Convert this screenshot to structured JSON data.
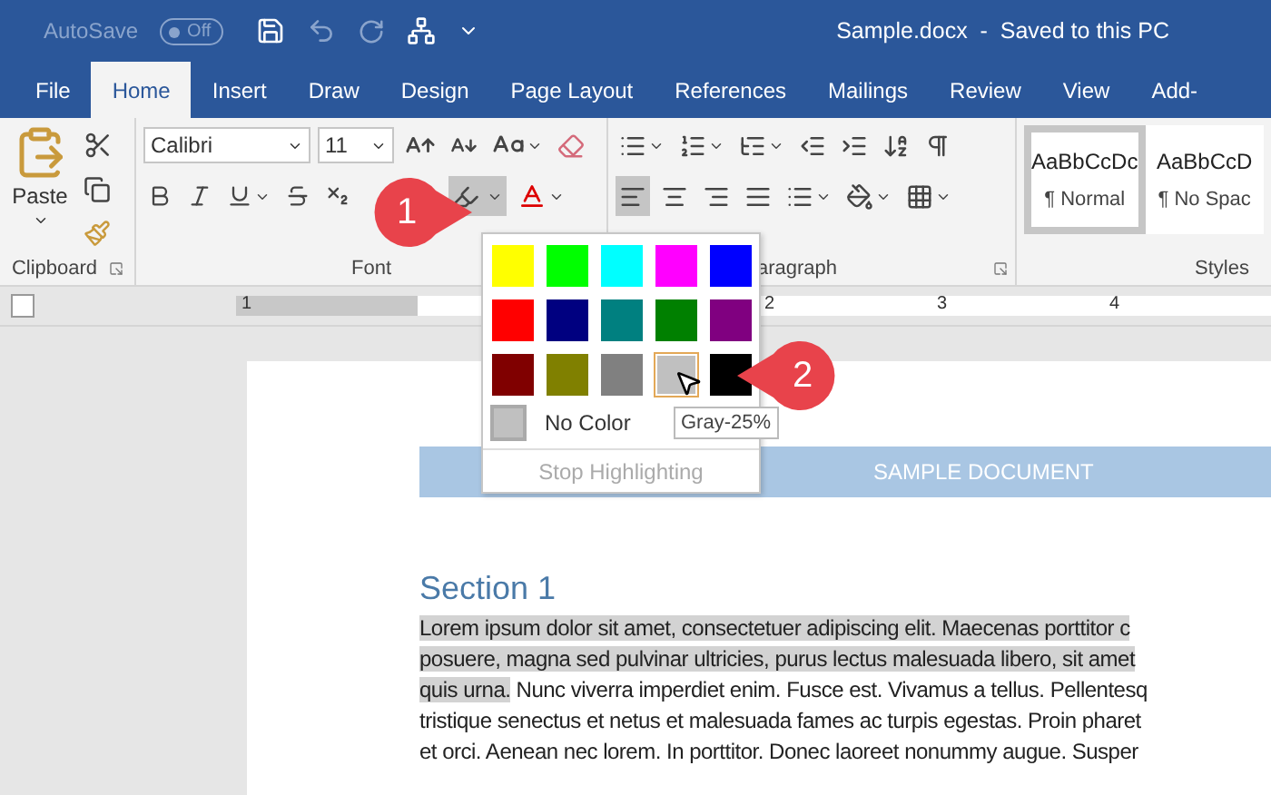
{
  "title_bar": {
    "autosave_label": "AutoSave",
    "autosave_state": "Off",
    "autosave_on": false,
    "document_title": "Sample.docx  -  Saved to this PC"
  },
  "tabs": [
    {
      "label": "File",
      "selected": false
    },
    {
      "label": "Home",
      "selected": true
    },
    {
      "label": "Insert",
      "selected": false
    },
    {
      "label": "Draw",
      "selected": false
    },
    {
      "label": "Design",
      "selected": false
    },
    {
      "label": "Page Layout",
      "selected": false
    },
    {
      "label": "References",
      "selected": false
    },
    {
      "label": "Mailings",
      "selected": false
    },
    {
      "label": "Review",
      "selected": false
    },
    {
      "label": "View",
      "selected": false
    },
    {
      "label": "Add-",
      "selected": false
    }
  ],
  "ribbon": {
    "clipboard": {
      "paste_label": "Paste",
      "group_label": "Clipboard"
    },
    "font": {
      "font_name": "Calibri",
      "font_size": "11",
      "highlight_open": true,
      "group_label": "Font"
    },
    "paragraph": {
      "alignments": [
        {
          "kind": "left",
          "selected": true
        },
        {
          "kind": "center",
          "selected": false
        },
        {
          "kind": "right",
          "selected": false
        },
        {
          "kind": "justify",
          "selected": false
        }
      ],
      "group_label": "aragraph"
    },
    "styles": {
      "items": [
        {
          "preview": "AaBbCcDc",
          "name": "¶ Normal",
          "selected": true
        },
        {
          "preview": "AaBbCcD",
          "name": "¶ No Spac",
          "selected": false
        }
      ],
      "group_label": "Styles"
    }
  },
  "ruler": {
    "numbers": [
      "1",
      "2",
      "3",
      "4"
    ]
  },
  "document": {
    "header_text": "SAMPLE DOCUMENT",
    "heading": "Section 1",
    "lines": [
      {
        "segments": [
          {
            "text": "Lorem ipsum dolor sit amet, consectetuer adipiscing elit. Maecenas porttitor c",
            "highlighted": true
          }
        ]
      },
      {
        "segments": [
          {
            "text": "posuere, magna sed pulvinar ultricies, purus lectus malesuada libero, sit amet",
            "highlighted": true
          }
        ]
      },
      {
        "segments": [
          {
            "text": "quis urna.",
            "highlighted": true
          },
          {
            "text": " Nunc viverra imperdiet enim. Fusce est. Vivamus a tellus. Pellentesq",
            "highlighted": false
          }
        ]
      },
      {
        "segments": [
          {
            "text": "tristique senectus et netus et malesuada fames ac turpis egestas. Proin pharet",
            "highlighted": false
          }
        ]
      },
      {
        "segments": [
          {
            "text": "et orci. Aenean nec lorem. In porttitor. Donec laoreet nonummy augue. Susper",
            "highlighted": false
          }
        ]
      }
    ]
  },
  "highlight_menu": {
    "swatches": [
      {
        "color": "#ffff00",
        "hovered": false
      },
      {
        "color": "#00ff00",
        "hovered": false
      },
      {
        "color": "#00ffff",
        "hovered": false
      },
      {
        "color": "#ff00ff",
        "hovered": false
      },
      {
        "color": "#0000ff",
        "hovered": false
      },
      {
        "color": "#ff0000",
        "hovered": false
      },
      {
        "color": "#000080",
        "hovered": false
      },
      {
        "color": "#008080",
        "hovered": false
      },
      {
        "color": "#008000",
        "hovered": false
      },
      {
        "color": "#800080",
        "hovered": false
      },
      {
        "color": "#800000",
        "hovered": false
      },
      {
        "color": "#808000",
        "hovered": false
      },
      {
        "color": "#808080",
        "hovered": false
      },
      {
        "color": "#c0c0c0",
        "hovered": true
      },
      {
        "color": "#000000",
        "hovered": false
      }
    ],
    "no_color_label": "No Color",
    "stop_label": "Stop Highlighting",
    "stop_disabled": true
  },
  "tooltip": "Gray-25%",
  "callouts": [
    "1",
    "2"
  ]
}
